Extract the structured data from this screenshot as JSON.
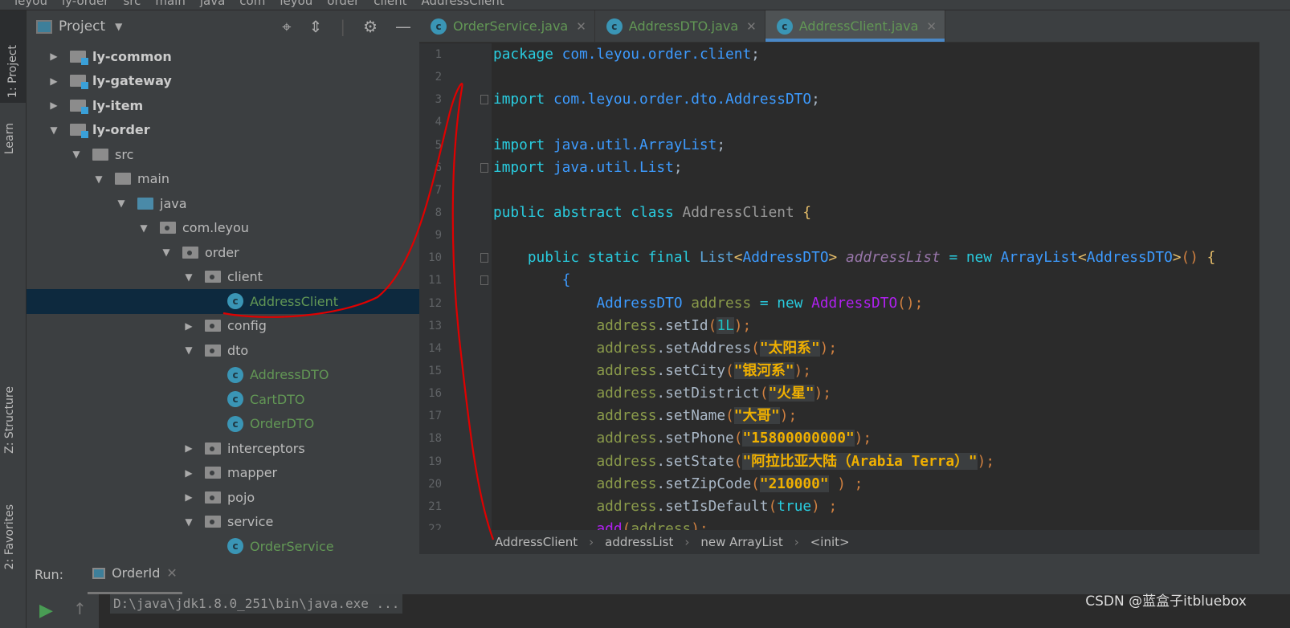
{
  "breadcrumb_top": [
    "leyou",
    "ly-order",
    "src",
    "main",
    "java",
    "com",
    "leyou",
    "order",
    "client",
    "AddressClient"
  ],
  "left_strip": {
    "project": "1: Project",
    "learn": "Learn",
    "structure": "Z: Structure",
    "favorites": "2: Favorites"
  },
  "project_panel": {
    "title": "Project",
    "tools": [
      "locate-icon",
      "collapse-icon",
      "gear-icon",
      "minimize-icon"
    ]
  },
  "tree": [
    {
      "label": "ly-common",
      "level": 0,
      "type": "module",
      "expanded": false
    },
    {
      "label": "ly-gateway",
      "level": 0,
      "type": "module",
      "expanded": false
    },
    {
      "label": "ly-item",
      "level": 0,
      "type": "module",
      "expanded": false
    },
    {
      "label": "ly-order",
      "level": 0,
      "type": "module",
      "expanded": true
    },
    {
      "label": "src",
      "level": 1,
      "type": "folder",
      "expanded": true
    },
    {
      "label": "main",
      "level": 2,
      "type": "folder",
      "expanded": true
    },
    {
      "label": "java",
      "level": 3,
      "type": "source",
      "expanded": true
    },
    {
      "label": "com.leyou",
      "level": 4,
      "type": "package",
      "expanded": true
    },
    {
      "label": "order",
      "level": 5,
      "type": "package",
      "expanded": true
    },
    {
      "label": "client",
      "level": 6,
      "type": "package",
      "expanded": true
    },
    {
      "label": "AddressClient",
      "level": 7,
      "type": "abstract-class",
      "selected": true
    },
    {
      "label": "config",
      "level": 6,
      "type": "package",
      "expanded": false
    },
    {
      "label": "dto",
      "level": 6,
      "type": "package",
      "expanded": true
    },
    {
      "label": "AddressDTO",
      "level": 7,
      "type": "class"
    },
    {
      "label": "CartDTO",
      "level": 7,
      "type": "class"
    },
    {
      "label": "OrderDTO",
      "level": 7,
      "type": "class"
    },
    {
      "label": "interceptors",
      "level": 6,
      "type": "package",
      "expanded": false
    },
    {
      "label": "mapper",
      "level": 6,
      "type": "package",
      "expanded": false
    },
    {
      "label": "pojo",
      "level": 6,
      "type": "package",
      "expanded": false
    },
    {
      "label": "service",
      "level": 6,
      "type": "package",
      "expanded": true
    },
    {
      "label": "OrderService",
      "level": 7,
      "type": "class"
    }
  ],
  "tabs": [
    {
      "label": "OrderService.java",
      "active": false
    },
    {
      "label": "AddressDTO.java",
      "active": false
    },
    {
      "label": "AddressClient.java",
      "active": true
    }
  ],
  "code": [
    {
      "n": "1",
      "t": [
        [
          "kw",
          "package "
        ],
        [
          "ty",
          "com.leyou.order.client"
        ],
        [
          "pl",
          ";"
        ]
      ]
    },
    {
      "n": "2",
      "t": []
    },
    {
      "n": "3",
      "f": true,
      "t": [
        [
          "kw",
          "import "
        ],
        [
          "ty",
          "com.leyou.order.dto.AddressDTO"
        ],
        [
          "pl",
          ";"
        ]
      ]
    },
    {
      "n": "4",
      "t": []
    },
    {
      "n": "5",
      "t": [
        [
          "kw",
          "import "
        ],
        [
          "ty",
          "java.util.ArrayList"
        ],
        [
          "pl",
          ";"
        ]
      ]
    },
    {
      "n": "6",
      "f": true,
      "t": [
        [
          "kw",
          "import "
        ],
        [
          "ty",
          "java.util.List"
        ],
        [
          "pl",
          ";"
        ]
      ]
    },
    {
      "n": "7",
      "t": []
    },
    {
      "n": "8",
      "t": [
        [
          "kw",
          "public abstract class "
        ],
        [
          "cn",
          "AddressClient "
        ],
        [
          "br",
          "{"
        ]
      ]
    },
    {
      "n": "9",
      "t": []
    },
    {
      "n": "10",
      "f": true,
      "t": [
        [
          "pl",
          "    "
        ],
        [
          "kw",
          "public static final "
        ],
        [
          "li",
          "List"
        ],
        [
          "br",
          "<"
        ],
        [
          "ty",
          "AddressDTO"
        ],
        [
          "br",
          "> "
        ],
        [
          "it",
          "addressList"
        ],
        [
          "kw",
          " = new "
        ],
        [
          "ty",
          "ArrayList"
        ],
        [
          "br",
          "<"
        ],
        [
          "ty",
          "AddressDTO"
        ],
        [
          "br",
          ">"
        ],
        [
          "pa",
          "() "
        ],
        [
          "br",
          "{"
        ]
      ]
    },
    {
      "n": "11",
      "f": true,
      "t": [
        [
          "pl",
          "        "
        ],
        [
          "ty",
          "{"
        ]
      ]
    },
    {
      "n": "12",
      "t": [
        [
          "pl",
          "            "
        ],
        [
          "ty",
          "AddressDTO "
        ],
        [
          "va",
          "address"
        ],
        [
          "kw",
          " = new "
        ],
        [
          "pu",
          "AddressDTO"
        ],
        [
          "pa",
          "()"
        ],
        [
          "pa",
          ";"
        ]
      ]
    },
    {
      "n": "13",
      "t": [
        [
          "pl",
          "            "
        ],
        [
          "va",
          "address"
        ],
        [
          "me",
          ".setId"
        ],
        [
          "pa",
          "("
        ],
        [
          "nu",
          "1L"
        ],
        [
          "pa",
          ")"
        ],
        [
          "pa",
          ";"
        ]
      ]
    },
    {
      "n": "14",
      "t": [
        [
          "pl",
          "            "
        ],
        [
          "va",
          "address"
        ],
        [
          "me",
          ".setAddress"
        ],
        [
          "pa",
          "("
        ],
        [
          "st",
          "\"太阳系\""
        ],
        [
          "pa",
          ")"
        ],
        [
          "pa",
          ";"
        ]
      ]
    },
    {
      "n": "15",
      "t": [
        [
          "pl",
          "            "
        ],
        [
          "va",
          "address"
        ],
        [
          "me",
          ".setCity"
        ],
        [
          "pa",
          "("
        ],
        [
          "st",
          "\"银河系\""
        ],
        [
          "pa",
          ")"
        ],
        [
          "pa",
          ";"
        ]
      ]
    },
    {
      "n": "16",
      "t": [
        [
          "pl",
          "            "
        ],
        [
          "va",
          "address"
        ],
        [
          "me",
          ".setDistrict"
        ],
        [
          "pa",
          "("
        ],
        [
          "st",
          "\"火星\""
        ],
        [
          "pa",
          ")"
        ],
        [
          "pa",
          ";"
        ]
      ]
    },
    {
      "n": "17",
      "t": [
        [
          "pl",
          "            "
        ],
        [
          "va",
          "address"
        ],
        [
          "me",
          ".setName"
        ],
        [
          "pa",
          "("
        ],
        [
          "st",
          "\"大哥\""
        ],
        [
          "pa",
          ")"
        ],
        [
          "pa",
          ";"
        ]
      ]
    },
    {
      "n": "18",
      "t": [
        [
          "pl",
          "            "
        ],
        [
          "va",
          "address"
        ],
        [
          "me",
          ".setPhone"
        ],
        [
          "pa",
          "("
        ],
        [
          "st",
          "\"15800000000\""
        ],
        [
          "pa",
          ")"
        ],
        [
          "pa",
          ";"
        ]
      ]
    },
    {
      "n": "19",
      "t": [
        [
          "pl",
          "            "
        ],
        [
          "va",
          "address"
        ],
        [
          "me",
          ".setState"
        ],
        [
          "pa",
          "("
        ],
        [
          "st",
          "\"阿拉比亚大陆（Arabia Terra）\""
        ],
        [
          "pa",
          ")"
        ],
        [
          "pa",
          ";"
        ]
      ]
    },
    {
      "n": "20",
      "t": [
        [
          "pl",
          "            "
        ],
        [
          "va",
          "address"
        ],
        [
          "me",
          ".setZipCode"
        ],
        [
          "pa",
          "("
        ],
        [
          "st",
          "\"210000\""
        ],
        [
          "pa",
          " ) ;"
        ]
      ]
    },
    {
      "n": "21",
      "t": [
        [
          "pl",
          "            "
        ],
        [
          "va",
          "address"
        ],
        [
          "me",
          ".setIsDefault"
        ],
        [
          "pa",
          "("
        ],
        [
          "kw",
          "true"
        ],
        [
          "pa",
          ") ;"
        ]
      ]
    },
    {
      "n": "22",
      "t": [
        [
          "pl",
          "            "
        ],
        [
          "pu",
          "add"
        ],
        [
          "pa",
          "("
        ],
        [
          "va",
          "address"
        ],
        [
          "pa",
          ");"
        ]
      ]
    }
  ],
  "editor_breadcrumb": [
    "AddressClient",
    "addressList",
    "new ArrayList",
    "<init>"
  ],
  "run": {
    "label": "Run:",
    "tab": "OrderId",
    "command": "D:\\java\\jdk1.8.0_251\\bin\\java.exe ..."
  },
  "watermark": "CSDN @蓝盒子itbluebox",
  "colors": {
    "accent": "#4a88c7",
    "selection": "#0d293e",
    "annotation": "#e00000"
  }
}
